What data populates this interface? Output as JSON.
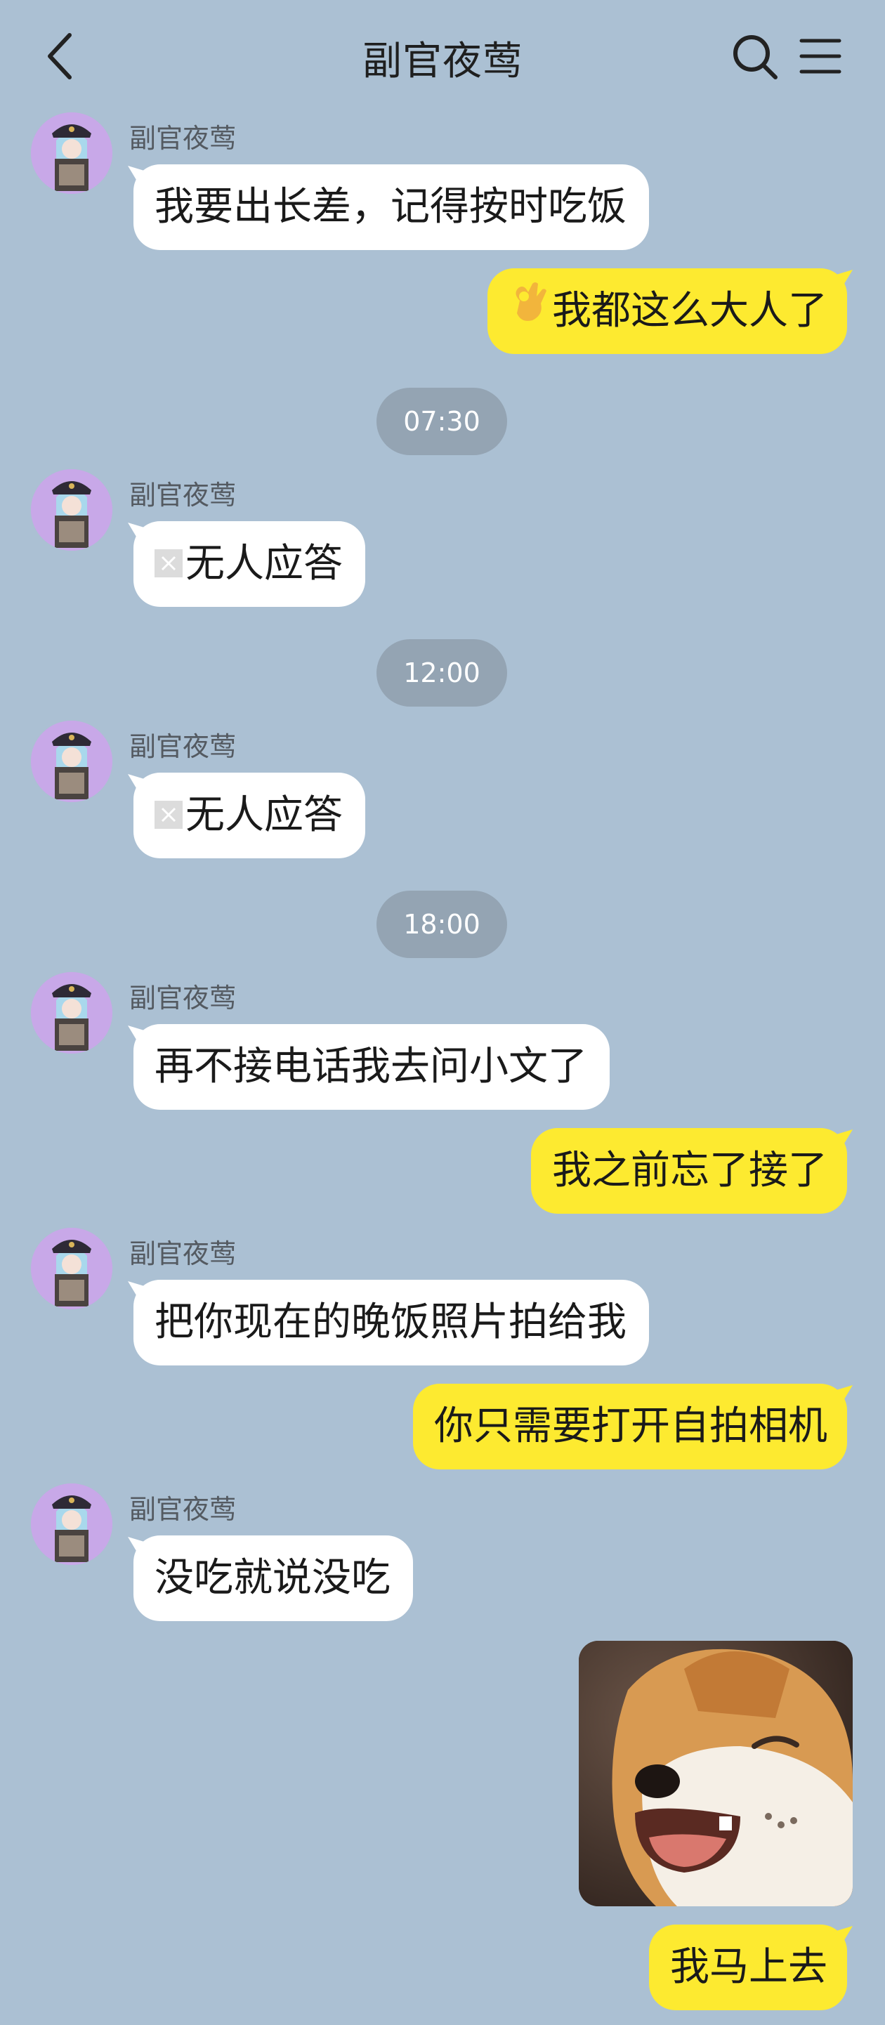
{
  "header": {
    "title": "副官夜莺",
    "back_icon": "chevron-left-icon",
    "search_icon": "search-icon",
    "menu_icon": "hamburger-menu-icon"
  },
  "contact": {
    "name": "副官夜莺",
    "avatar_icon": "avatar-anime-officer"
  },
  "messages": [
    {
      "side": "left",
      "sender": "副官夜莺",
      "text": "我要出长差，记得按时吃饭"
    },
    {
      "side": "right",
      "text": "我都这么大人了",
      "emoji": "ok-hand-emoji"
    },
    {
      "type": "time",
      "text": "07:30"
    },
    {
      "side": "left",
      "sender": "副官夜莺",
      "text": "无人应答",
      "icon": "missed-call-icon"
    },
    {
      "type": "time",
      "text": "12:00"
    },
    {
      "side": "left",
      "sender": "副官夜莺",
      "text": "无人应答",
      "icon": "missed-call-icon"
    },
    {
      "type": "time",
      "text": "18:00"
    },
    {
      "side": "left",
      "sender": "副官夜莺",
      "text": "再不接电话我去问小文了"
    },
    {
      "side": "right",
      "text": "我之前忘了接了"
    },
    {
      "side": "left",
      "sender": "副官夜莺",
      "text": "把你现在的晚饭照片拍给我"
    },
    {
      "side": "right",
      "text": "你只需要打开自拍相机"
    },
    {
      "side": "left",
      "sender": "副官夜莺",
      "text": "没吃就说没吃"
    },
    {
      "side": "right",
      "type": "sticker",
      "sticker": "shiba-dog-laughing-sticker"
    },
    {
      "side": "right",
      "text": "我马上去"
    }
  ],
  "colors": {
    "background": "#abc0d3",
    "incoming_bubble": "#ffffff",
    "outgoing_bubble": "#fdea30",
    "timestamp_pill": "#94a4b3"
  }
}
